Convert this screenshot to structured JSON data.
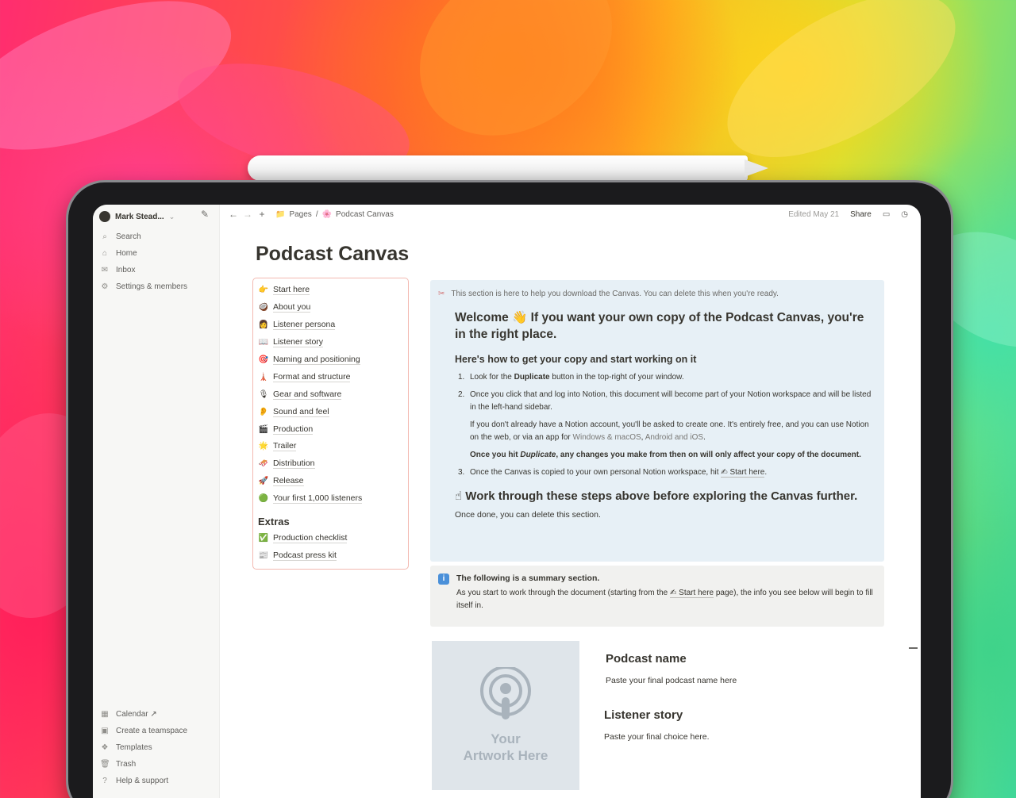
{
  "sidebar": {
    "workspace": "Mark Stead...",
    "nav": [
      {
        "icon": "search-icon",
        "glyph": "⌕",
        "label": "Search"
      },
      {
        "icon": "home-icon",
        "glyph": "⌂",
        "label": "Home"
      },
      {
        "icon": "inbox-icon",
        "glyph": "✉",
        "label": "Inbox"
      },
      {
        "icon": "settings-icon",
        "glyph": "⚙",
        "label": "Settings & members"
      }
    ],
    "footer": [
      {
        "icon": "calendar-icon",
        "glyph": "▦",
        "label": "Calendar ↗"
      },
      {
        "icon": "teamspace-icon",
        "glyph": "▣",
        "label": "Create a teamspace"
      },
      {
        "icon": "templates-icon",
        "glyph": "❖",
        "label": "Templates"
      },
      {
        "icon": "trash-icon",
        "glyph": "🗑",
        "label": "Trash"
      },
      {
        "icon": "help-icon",
        "glyph": "?",
        "label": "Help & support"
      }
    ]
  },
  "topbar": {
    "crumb_pages": "Pages",
    "crumb_sep": "/",
    "crumb_page": "Podcast Canvas",
    "edited": "Edited May 21",
    "share": "Share"
  },
  "page": {
    "title": "Podcast Canvas"
  },
  "toc": {
    "items": [
      {
        "emoji": "👉",
        "label": "Start here"
      },
      {
        "emoji": "🥥",
        "label": "About you"
      },
      {
        "emoji": "👩",
        "label": "Listener persona"
      },
      {
        "emoji": "📖",
        "label": "Listener story"
      },
      {
        "emoji": "🎯",
        "label": "Naming and positioning"
      },
      {
        "emoji": "🗼",
        "label": "Format and structure"
      },
      {
        "emoji": "🎙",
        "label": "Gear and software"
      },
      {
        "emoji": "👂",
        "label": "Sound and feel"
      },
      {
        "emoji": "🎬",
        "label": "Production"
      },
      {
        "emoji": "🌟",
        "label": "Trailer"
      },
      {
        "emoji": "🛷",
        "label": "Distribution"
      },
      {
        "emoji": "🚀",
        "label": "Release"
      },
      {
        "emoji": "🟢",
        "label": "Your first 1,000 listeners"
      }
    ],
    "extras_heading": "Extras",
    "extras": [
      {
        "emoji": "✅",
        "label": "Production checklist"
      },
      {
        "emoji": "📰",
        "label": "Podcast press kit"
      }
    ]
  },
  "callout_download": {
    "note": "This section is here to help you download the Canvas. You can delete this when you're ready.",
    "welcome": "Welcome 👋 If you want your own copy of the Podcast Canvas, you're in the right place.",
    "howto_heading": "Here's how to get your copy and start working on it",
    "step1_num": "1.",
    "step1_a": "Look for the ",
    "step1_b": "Duplicate",
    "step1_c": " button in the top-right of your window.",
    "step2_num": "2.",
    "step2_p1": "Once you click that and log into Notion, this document will become part of your Notion workspace and will be listed in the left-hand sidebar.",
    "step2_p2a": "If you don't already have a Notion account, you'll be asked to create one. It's entirely free, and you can use Notion on the web, or via an app for ",
    "step2_link1": "Windows & macOS",
    "step2_comma": ", ",
    "step2_link2": "Android and iOS",
    "step2_p2b": ".",
    "step2_p3a": "Once you hit ",
    "step2_p3b": "Duplicate",
    "step2_p3c": ", any changes you make from then on will only affect your copy of the document.",
    "step3_num": "3.",
    "step3_a": "Once the Canvas is copied to your own personal Notion workspace, hit ",
    "step3_link": "✍ Start here",
    "step3_b": ".",
    "workthrough": "☝ Work through these steps above before exploring the Canvas further.",
    "once_done": "Once done, you can delete this section."
  },
  "callout_summary": {
    "icon_glyph": "i",
    "title": "The following is a summary section.",
    "body_a": "As you start to work through the document (starting from the ",
    "body_link": "✍ Start here",
    "body_b": " page), the info you see below will begin to fill itself in."
  },
  "artwork": {
    "line1": "Your",
    "line2": "Artwork Here"
  },
  "fields": {
    "podcast_name_heading": "Podcast name",
    "podcast_name_value": "Paste your final podcast name here",
    "listener_story_heading": "Listener story",
    "listener_story_value": "Paste your final choice here."
  },
  "colors": {
    "callout_blue": "#e7f0f6",
    "callout_gray": "#f1f1ef",
    "toc_border": "#f3b9b0",
    "text": "#37352f"
  }
}
